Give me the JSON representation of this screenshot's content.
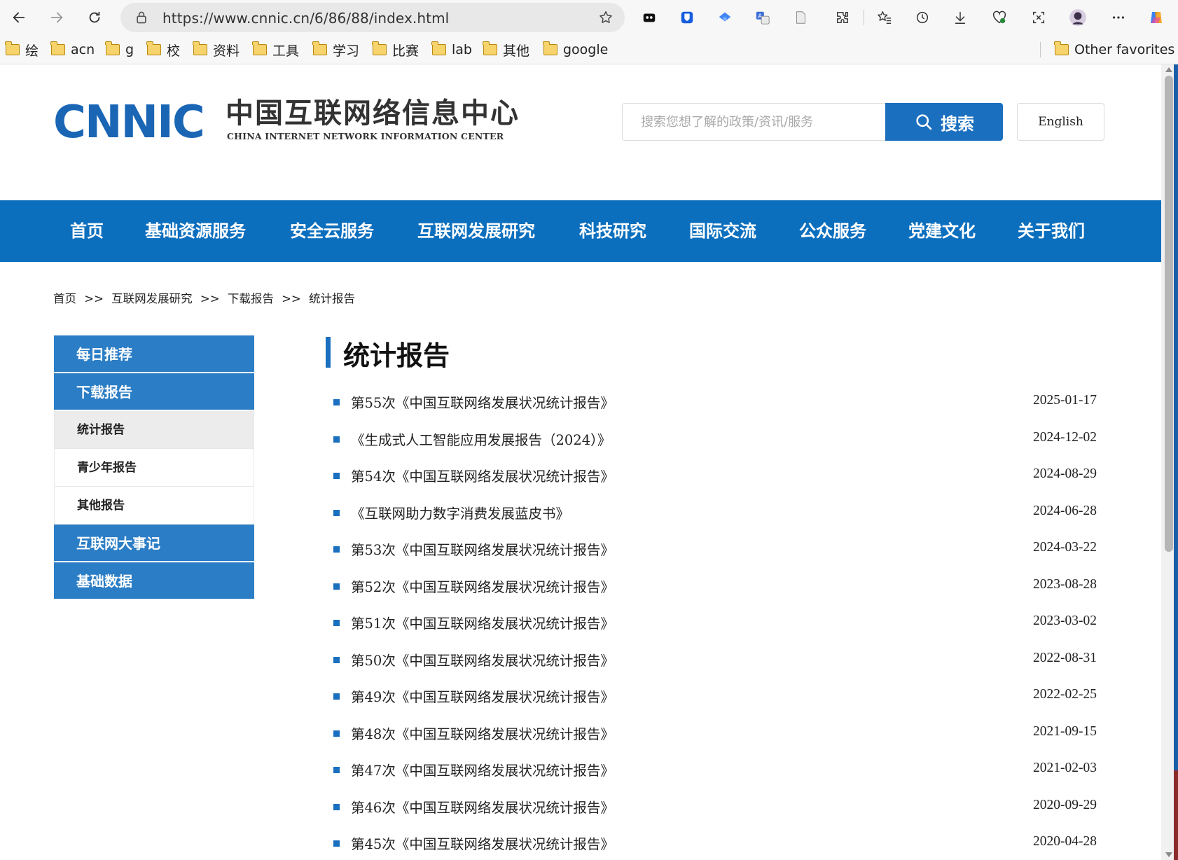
{
  "browser": {
    "url": "https://www.cnnic.cn/6/86/88/index.html",
    "bookmarks": [
      "绘",
      "acn",
      "g",
      "校",
      "资料",
      "工具",
      "学习",
      "比赛",
      "lab",
      "其他",
      "google"
    ],
    "other_favorites": "Other favorites"
  },
  "header": {
    "logo_text": "CNNIC",
    "logo_cn": "中国互联网络信息中心",
    "logo_en": "CHINA INTERNET NETWORK INFORMATION CENTER",
    "search_placeholder": "搜索您想了解的政策/资讯/服务",
    "search_button": "搜索",
    "english_button": "English"
  },
  "nav": {
    "items": [
      "首页",
      "基础资源服务",
      "安全云服务",
      "互联网发展研究",
      "科技研究",
      "国际交流",
      "公众服务",
      "党建文化",
      "关于我们"
    ]
  },
  "breadcrumb": {
    "items": [
      "首页",
      ">>",
      "互联网发展研究",
      ">>",
      "下载报告",
      ">>",
      "统计报告"
    ]
  },
  "sidebar": {
    "daily": "每日推荐",
    "download": "下载报告",
    "sub": [
      "统计报告",
      "青少年报告",
      "其他报告"
    ],
    "events": "互联网大事记",
    "basic_data": "基础数据"
  },
  "content": {
    "title": "统计报告",
    "reports": [
      {
        "title": "第55次《中国互联网络发展状况统计报告》",
        "date": "2025-01-17"
      },
      {
        "title": "《生成式人工智能应用发展报告（2024）》",
        "date": "2024-12-02"
      },
      {
        "title": "第54次《中国互联网络发展状况统计报告》",
        "date": "2024-08-29"
      },
      {
        "title": "《互联网助力数字消费发展蓝皮书》",
        "date": "2024-06-28"
      },
      {
        "title": "第53次《中国互联网络发展状况统计报告》",
        "date": "2024-03-22"
      },
      {
        "title": "第52次《中国互联网络发展状况统计报告》",
        "date": "2023-08-28"
      },
      {
        "title": "第51次《中国互联网络发展状况统计报告》",
        "date": "2023-03-02"
      },
      {
        "title": "第50次《中国互联网络发展状况统计报告》",
        "date": "2022-08-31"
      },
      {
        "title": "第49次《中国互联网络发展状况统计报告》",
        "date": "2022-02-25"
      },
      {
        "title": "第48次《中国互联网络发展状况统计报告》",
        "date": "2021-09-15"
      },
      {
        "title": "第47次《中国互联网络发展状况统计报告》",
        "date": "2021-02-03"
      },
      {
        "title": "第46次《中国互联网络发展状况统计报告》",
        "date": "2020-09-29"
      },
      {
        "title": "第45次《中国互联网络发展状况统计报告》",
        "date": "2020-04-28"
      }
    ]
  },
  "icons": {
    "back": "back-arrow-icon",
    "forward": "forward-arrow-icon",
    "refresh": "refresh-icon",
    "lock": "lock-icon",
    "star": "favorite-star-icon",
    "search": "search-icon",
    "folder": "folder-icon"
  },
  "colors": {
    "brand_blue": "#0c6fbe",
    "sidebar_blue": "#2b7dc5",
    "logo_blue": "#1a66b5"
  }
}
